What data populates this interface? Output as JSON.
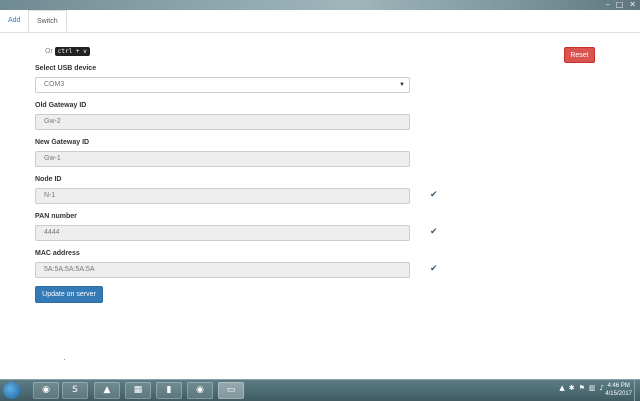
{
  "window": {
    "controls": [
      "–",
      "□",
      "✕"
    ]
  },
  "tabs": [
    {
      "label": "Add",
      "active": false
    },
    {
      "label": "Switch",
      "active": true
    }
  ],
  "hint": {
    "prefix": "Or",
    "shortcut": "ctrl + v"
  },
  "reset_label": "Reset",
  "form": {
    "usb": {
      "label": "Select USB device",
      "value": "COM3"
    },
    "old_gateway": {
      "label": "Old Gateway ID",
      "value": "Gw-2"
    },
    "new_gateway": {
      "label": "New Gateway ID",
      "value": "Gw-1"
    },
    "node": {
      "label": "Node ID",
      "value": "N-1"
    },
    "pan": {
      "label": "PAN number",
      "value": "4444"
    },
    "mac": {
      "label": "MAC address",
      "value": "5A:5A:5A:5A:5A"
    }
  },
  "update_label": "Update on server",
  "taskbar": {
    "items": [
      {
        "name": "chrome",
        "glyph": "◉"
      },
      {
        "name": "sublime",
        "glyph": "S"
      },
      {
        "name": "vlc",
        "glyph": "▲"
      },
      {
        "name": "media",
        "glyph": "▦"
      },
      {
        "name": "folder",
        "glyph": "▮"
      },
      {
        "name": "chrome",
        "glyph": "◉"
      },
      {
        "name": "app",
        "glyph": "▭"
      }
    ],
    "time": "4:46 PM",
    "date": "4/15/2017"
  },
  "colors": {
    "primary": "#337ab7",
    "danger": "#d9534f",
    "taskbar": "#4b6a71"
  }
}
